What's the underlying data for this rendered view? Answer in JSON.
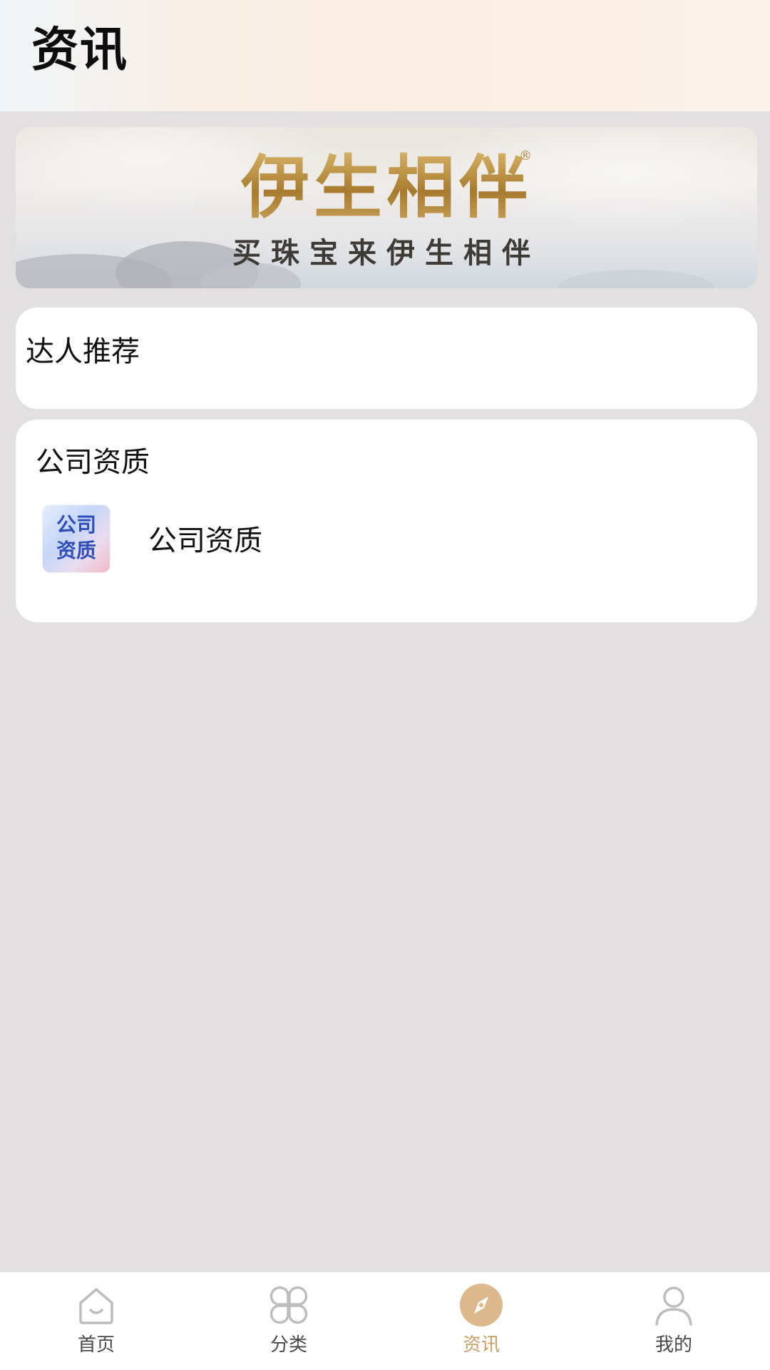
{
  "header": {
    "title": "资讯"
  },
  "banner": {
    "logo_text": "伊生相伴",
    "registered_mark": "®",
    "slogan": "买珠宝来伊生相伴"
  },
  "sections": {
    "recommend": {
      "title": "达人推荐"
    },
    "qualification": {
      "title": "公司资质",
      "items": [
        {
          "thumb_line1": "公司",
          "thumb_line2": "资质",
          "label": "公司资质"
        }
      ]
    }
  },
  "tabbar": {
    "tabs": [
      {
        "label": "首页",
        "icon": "home-icon",
        "active": false
      },
      {
        "label": "分类",
        "icon": "category-icon",
        "active": false
      },
      {
        "label": "资讯",
        "icon": "compass-icon",
        "active": true
      },
      {
        "label": "我的",
        "icon": "user-icon",
        "active": false
      }
    ],
    "active_color": "#c9a06a",
    "inactive_color": "#4a4a4a"
  }
}
